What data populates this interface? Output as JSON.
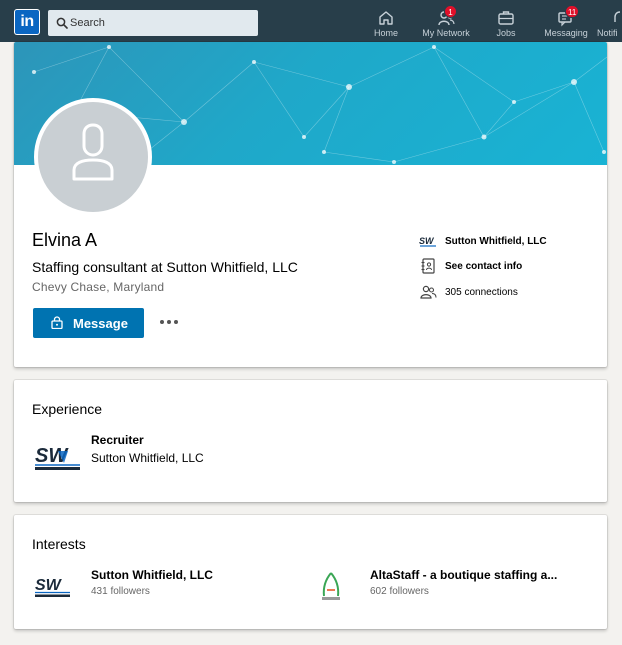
{
  "nav": {
    "logo": "in",
    "search_placeholder": "Search",
    "items": [
      {
        "label": "Home",
        "icon": "home-icon"
      },
      {
        "label": "My Network",
        "icon": "network-icon",
        "badge": "1"
      },
      {
        "label": "Jobs",
        "icon": "jobs-icon"
      },
      {
        "label": "Messaging",
        "icon": "messaging-icon",
        "badge": "11"
      },
      {
        "label": "Notifi",
        "icon": "notifications-icon"
      }
    ]
  },
  "profile": {
    "name": "Elvina A",
    "headline": "Staffing consultant at Sutton Whitfield, LLC",
    "location": "Chevy Chase, Maryland",
    "message_label": "Message",
    "sidebar": {
      "company": "Sutton Whitfield, LLC",
      "contact": "See contact info",
      "connections": "305 connections"
    }
  },
  "experience": {
    "title": "Experience",
    "items": [
      {
        "role": "Recruiter",
        "company": "Sutton Whitfield, LLC"
      }
    ]
  },
  "interests": {
    "title": "Interests",
    "items": [
      {
        "name": "Sutton Whitfield, LLC",
        "followers": "431 followers"
      },
      {
        "name": "AltaStaff - a boutique staffing a...",
        "followers": "602 followers"
      }
    ]
  },
  "colors": {
    "nav_bg": "#283e4a",
    "primary_button": "#0073b1",
    "badge": "#e0102a",
    "banner": "#1fa8c9"
  }
}
